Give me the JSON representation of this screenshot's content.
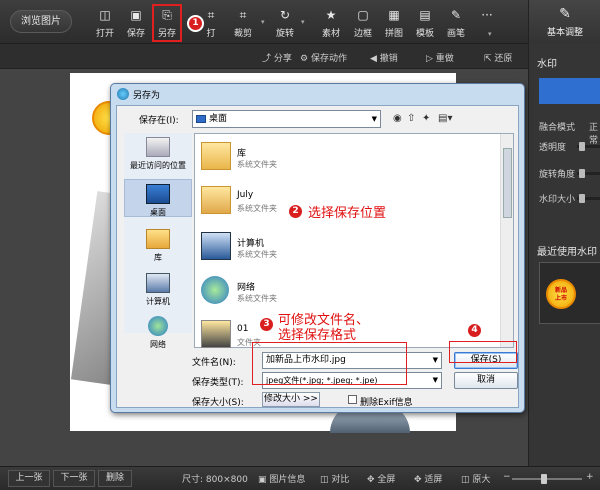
{
  "toolbar": {
    "browse": "浏览图片",
    "open": "打开",
    "save": "保存",
    "saveas": "另存",
    "print": "打",
    "crop": "裁剪",
    "rotate": "旋转",
    "material": "素材",
    "border": "边框",
    "collage": "拼图",
    "template": "模板",
    "brush": "画笔",
    "more": "···"
  },
  "right_panel": {
    "basic_adjust": "基本调整",
    "watermark": "水印",
    "blend_mode_label": "融合模式",
    "blend_mode_value": "正常",
    "opacity_label": "透明度",
    "angle_label": "旋转角度",
    "size_label": "水印大小",
    "recent_title": "最近使用水印"
  },
  "subbar": {
    "share": "分享",
    "save_action": "保存动作",
    "undo": "撤销",
    "redo": "重做",
    "restore": "还原"
  },
  "dialog": {
    "title": "另存为",
    "save_in_label": "保存在(I):",
    "save_in_value": "桌面",
    "places": [
      "最近访问的位置",
      "桌面",
      "库",
      "计算机",
      "网络"
    ],
    "files": [
      {
        "name": "库",
        "type": "系统文件夹"
      },
      {
        "name": "July",
        "type": "系统文件夹"
      },
      {
        "name": "计算机",
        "type": "系统文件夹"
      },
      {
        "name": "网络",
        "type": "系统文件夹"
      },
      {
        "name": "01",
        "type": "文件夹"
      }
    ],
    "filename_label": "文件名(N):",
    "filename_value": "加新品上市水印.jpg",
    "filetype_label": "保存类型(T):",
    "filetype_value": "jpeg文件(*.jpg; *.jpeg; *.jpe)",
    "size_label": "保存大小(S):",
    "resize_button": "修改大小 >>",
    "exif_label": "删除Exif信息",
    "save_button": "保存(S)",
    "cancel_button": "取消"
  },
  "annotations": {
    "badge1": "1",
    "badge2": "2",
    "badge3": "3",
    "badge4": "4",
    "text2": "选择保存位置",
    "text3_line1": "可修改文件名、",
    "text3_line2": "选择保存格式"
  },
  "statusbar": {
    "prev": "上一张",
    "next": "下一张",
    "delete": "删除",
    "size": "尺寸: 800×800",
    "info": "图片信息",
    "compare": "对比",
    "fullscreen": "全屏",
    "fit": "适屏",
    "original": "原大"
  },
  "colors": {
    "annotation_red": "#e02020",
    "accent_blue": "#2f6fd0"
  }
}
